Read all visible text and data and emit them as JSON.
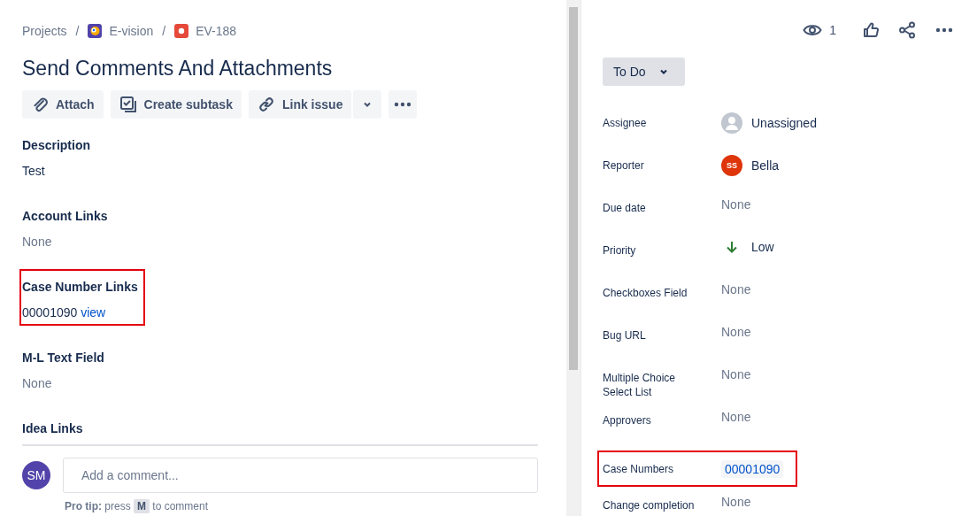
{
  "breadcrumbs": [
    {
      "label": "Projects"
    },
    {
      "label": "E-vision"
    },
    {
      "label": "EV-188"
    }
  ],
  "breadcrumb_separators": [
    "/",
    "/"
  ],
  "title": "Send Comments And Attachments",
  "actions": [
    {
      "label": "Attach"
    },
    {
      "label": "Create subtask"
    },
    {
      "label": "Link issue"
    }
  ],
  "sections": [
    {
      "heading": "Description",
      "kind": "text",
      "value": "Test"
    },
    {
      "heading": "Account Links",
      "kind": "empty",
      "value": "None"
    },
    {
      "heading": "Case Number Links",
      "kind": "link",
      "value": "00001090",
      "link": "view",
      "highlighted": true
    },
    {
      "heading": "M-L Text Field",
      "kind": "empty",
      "value": "None"
    },
    {
      "heading": "Idea Links",
      "kind": "heading"
    }
  ],
  "comment": {
    "avatar": "SM",
    "placeholder": "Add a comment...",
    "tip_label": "Pro tip:",
    "tip_before": "press",
    "tip_key": "M",
    "tip_after": "to comment"
  },
  "watchers": "1",
  "status": "To Do",
  "fields": [
    {
      "label": "Assignee",
      "kind": "user",
      "value": "Unassigned"
    },
    {
      "label": "Reporter",
      "kind": "initials",
      "avatar": "SS",
      "value": "Bella"
    },
    {
      "label": "Due date",
      "kind": "none",
      "value": "None"
    },
    {
      "label": "Priority",
      "kind": "priority",
      "value": "Low"
    },
    {
      "label": "Checkboxes Field",
      "kind": "none",
      "value": "None"
    },
    {
      "label": "Bug URL",
      "kind": "none",
      "value": "None"
    },
    {
      "label": "Multiple Choice Select List",
      "kind": "none",
      "value": "None"
    },
    {
      "label": "Approvers",
      "kind": "none",
      "value": "None"
    },
    {
      "label": "Case Numbers",
      "kind": "tag",
      "value": "00001090",
      "highlighted": true
    },
    {
      "label": "Change completion",
      "kind": "none",
      "value": "None"
    }
  ]
}
